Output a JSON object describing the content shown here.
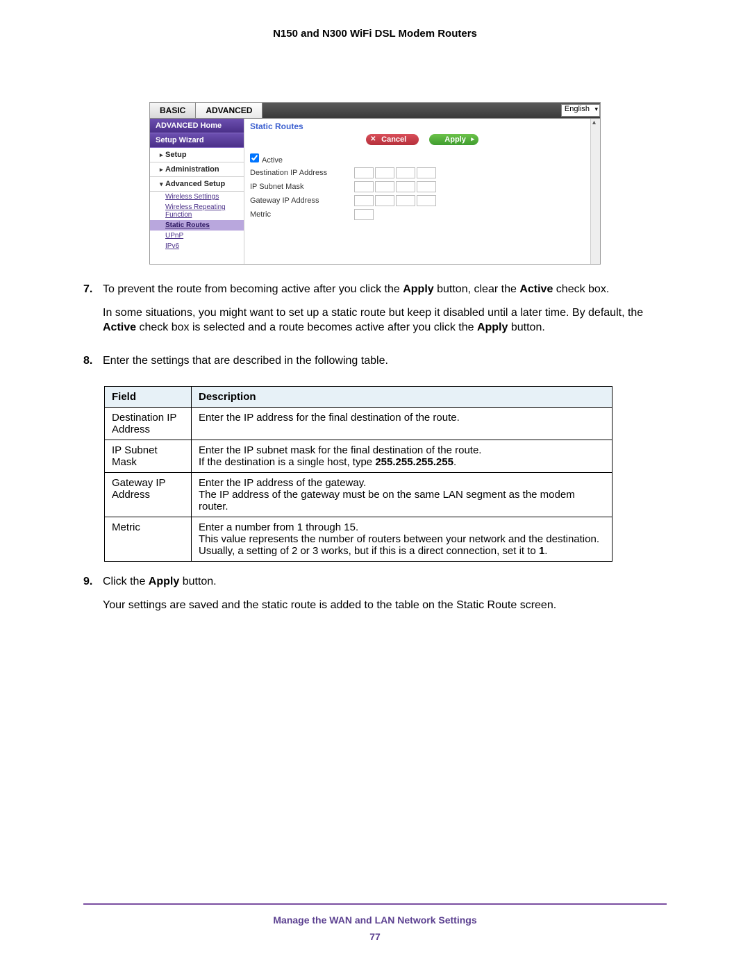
{
  "doc_title": "N150 and N300 WiFi DSL Modem Routers",
  "router_ui": {
    "tabs": {
      "basic": "BASIC",
      "advanced": "ADVANCED"
    },
    "language": "English",
    "sidebar": {
      "home": "ADVANCED Home",
      "wizard": "Setup Wizard",
      "items": [
        {
          "arrow": "▸",
          "label": "Setup"
        },
        {
          "arrow": "▸",
          "label": "Administration"
        },
        {
          "arrow": "▾",
          "label": "Advanced Setup"
        }
      ],
      "sub": [
        "Wireless Settings",
        "Wireless Repeating Function",
        "Static Routes",
        "UPnP",
        "IPv6"
      ]
    },
    "content": {
      "title": "Static Routes",
      "cancel": "Cancel",
      "apply": "Apply",
      "active_label": "Active",
      "fields": [
        "Destination IP Address",
        "IP Subnet Mask",
        "Gateway IP Address",
        "Metric"
      ]
    }
  },
  "steps": {
    "s7": {
      "num": "7.",
      "p1a": "To prevent the route from becoming active after you click the ",
      "p1b": "Apply",
      "p1c": " button, clear the ",
      "p1d": "Active",
      "p1e": " check box.",
      "p2a": "In some situations, you might want to set up a static route but keep it disabled until a later time. By default, the ",
      "p2b": "Active",
      "p2c": " check box is selected and a route becomes active after you click the ",
      "p2d": "Apply",
      "p2e": " button."
    },
    "s8": {
      "num": "8.",
      "p1": "Enter the settings that are described in the following table."
    },
    "s9": {
      "num": "9.",
      "p1a": "Click the ",
      "p1b": "Apply",
      "p1c": " button.",
      "p2": "Your settings are saved and the static route is added to the table on the Static Route screen."
    }
  },
  "table": {
    "headers": [
      "Field",
      "Description"
    ],
    "rows": [
      {
        "field": "Destination IP Address",
        "desc": [
          {
            "t": "Enter the IP address for the final destination of the route."
          }
        ]
      },
      {
        "field": "IP Subnet Mask",
        "desc": [
          {
            "t": "Enter the IP subnet mask for the final destination of the route."
          },
          {
            "t": "If the destination is a single host, type ",
            "bold_after": "255.255.255.255",
            "tail": "."
          }
        ]
      },
      {
        "field": "Gateway IP Address",
        "desc": [
          {
            "t": "Enter the IP address of the gateway."
          },
          {
            "t": "The IP address of the gateway must be on the same LAN segment as the modem router."
          }
        ]
      },
      {
        "field": "Metric",
        "desc": [
          {
            "t": "Enter a number from 1 through 15."
          },
          {
            "t": "This value represents the number of routers between your network and the destination. Usually, a setting of 2 or 3 works, but if this is a direct connection, set it to ",
            "bold_after": "1",
            "tail": "."
          }
        ]
      }
    ]
  },
  "footer": {
    "section": "Manage the WAN and LAN Network Settings",
    "page": "77"
  }
}
